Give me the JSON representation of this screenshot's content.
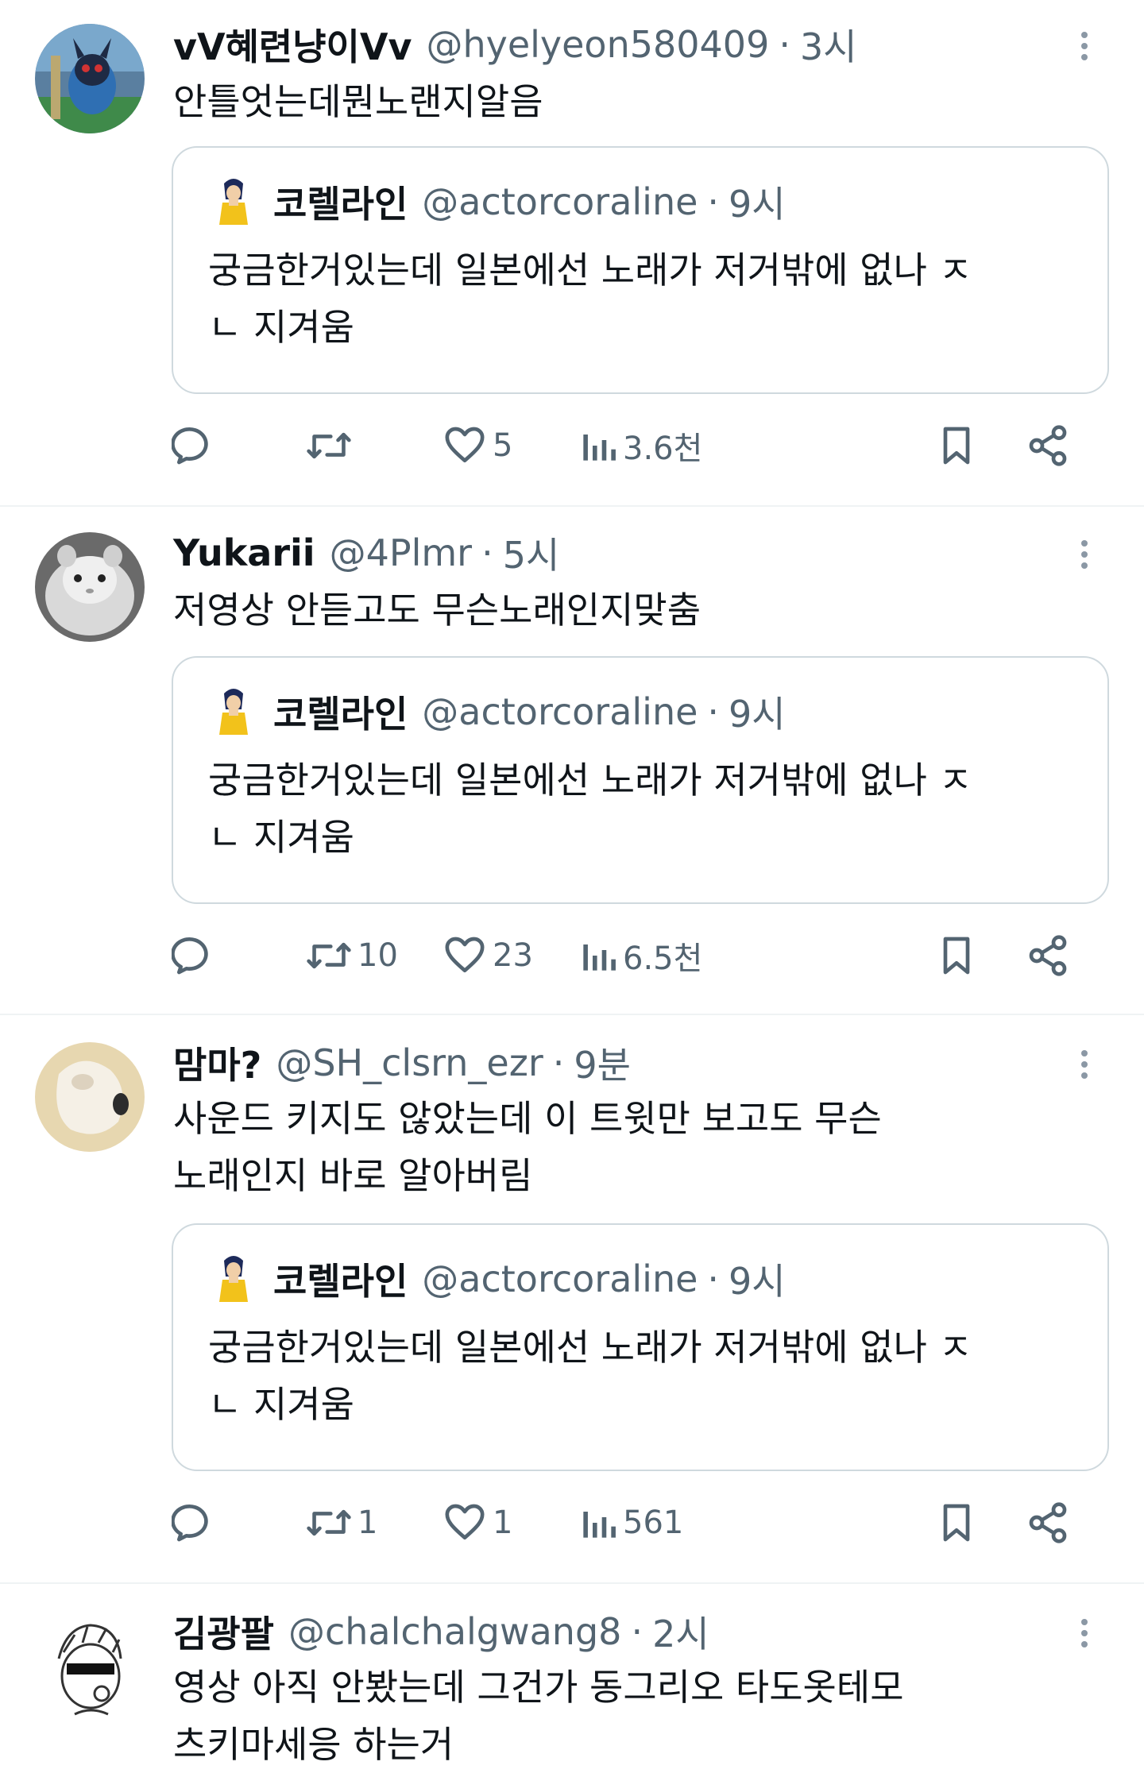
{
  "quoted": {
    "name": "코렐라인",
    "handle": "@actorcoraline",
    "sep": "·",
    "time": "9시",
    "text": "궁금한거있는데 일본에선 노래가 저거밖에 없나 ㅈ\nㄴ 지겨움"
  },
  "tweets": [
    {
      "name": "vV혜련냥이Vv",
      "handle": "@hyelyeon580409",
      "sep": "·",
      "time": "3시",
      "text": "안틀엇는데뭔노랜지알음",
      "reply_count": "",
      "retweet_count": "",
      "like_count": "5",
      "view_count": "3.6천"
    },
    {
      "name": "Yukarii",
      "handle": "@4Plmr",
      "sep": "·",
      "time": "5시",
      "text": "저영상 안듣고도 무슨노래인지맞춤",
      "reply_count": "",
      "retweet_count": "10",
      "like_count": "23",
      "view_count": "6.5천"
    },
    {
      "name": "맘마?",
      "handle": "@SH_clsrn_ezr",
      "sep": "·",
      "time": "9분",
      "text": "사운드 키지도 않았는데 이 트윗만 보고도 무슨\n노래인지 바로 알아버림",
      "reply_count": "",
      "retweet_count": "1",
      "like_count": "1",
      "view_count": "561"
    },
    {
      "name": "김광팔",
      "handle": "@chalchalgwang8",
      "sep": "·",
      "time": "2시",
      "text": "영상 아직 안봤는데 그건가 동그리오 타도옷테모\n츠키마세응 하는거"
    }
  ],
  "icons": {
    "reply": "reply-icon",
    "retweet": "retweet-icon",
    "like": "heart-icon",
    "views": "views-icon",
    "bookmark": "bookmark-icon",
    "share": "share-icon",
    "more": "more-icon"
  },
  "colors": {
    "text": "#0f1419",
    "secondary": "#536471",
    "border": "#cfd9de",
    "divider": "#eff3f4"
  }
}
